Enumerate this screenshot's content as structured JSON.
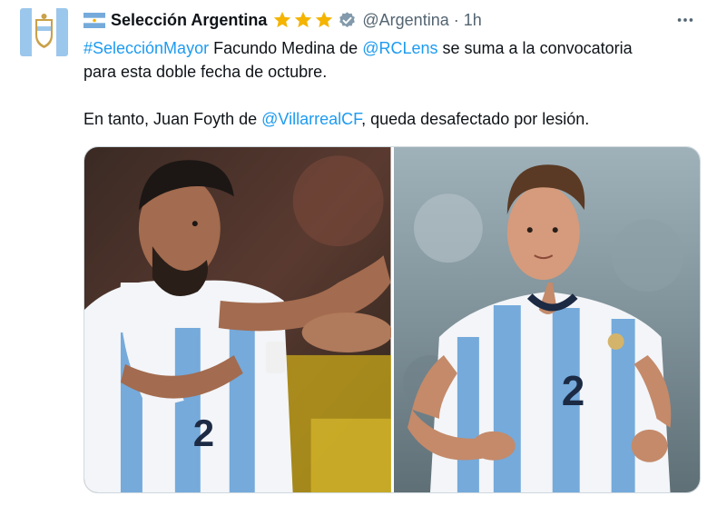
{
  "tweet": {
    "author": {
      "display_name": "Selección Argentina",
      "handle": "@Argentina",
      "avatar": "afa-crest-avatar",
      "flag": "argentina-flag-icon",
      "badges": [
        "star-icon",
        "star-icon",
        "star-icon",
        "verified-badge-icon"
      ]
    },
    "separator": "·",
    "time": "1h",
    "more_icon": "more-options-icon",
    "text": {
      "line1": {
        "hashtag": "#SelecciónMayor",
        "part1": " Facundo Medina de ",
        "mention": "@RCLens",
        "part2": " se suma a la convocatoria"
      },
      "line2": "para esta doble fecha de octubre.",
      "line3": {
        "part1": "En tanto, Juan Foyth de ",
        "mention": "@VillarrealCF",
        "part2": ", queda desafectado por lesión."
      }
    },
    "media": [
      {
        "name": "photo-facundo-medina",
        "jersey_number": "2"
      },
      {
        "name": "photo-juan-foyth",
        "jersey_number": "2"
      }
    ]
  },
  "colors": {
    "link": "#1d9bf0",
    "text": "#0f1419",
    "secondary": "#536471",
    "star": "#f4b400",
    "verified": "#829aab",
    "argentina_blue": "#75aadb"
  }
}
